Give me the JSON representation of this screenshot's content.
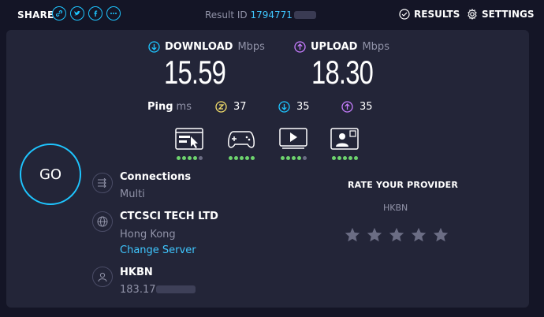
{
  "header": {
    "share_label": "SHARE",
    "result_id_label": "Result ID",
    "result_id_value": "1794771",
    "results_label": "RESULTS",
    "settings_label": "SETTINGS"
  },
  "download": {
    "label": "DOWNLOAD",
    "unit": "Mbps",
    "value": "15.59"
  },
  "upload": {
    "label": "UPLOAD",
    "unit": "Mbps",
    "value": "18.30"
  },
  "ping": {
    "label": "Ping",
    "unit": "ms",
    "idle": "37",
    "download": "35",
    "upload": "35"
  },
  "app_ratings": [
    {
      "icon": "web-browsing-icon",
      "score": 4,
      "max": 5
    },
    {
      "icon": "gaming-icon",
      "score": 5,
      "max": 5
    },
    {
      "icon": "video-streaming-icon",
      "score": 4,
      "max": 5
    },
    {
      "icon": "video-call-icon",
      "score": 5,
      "max": 5
    }
  ],
  "go_label": "GO",
  "connections": {
    "title": "Connections",
    "value": "Multi"
  },
  "server": {
    "title": "CTCSCI TECH LTD",
    "location": "Hong Kong",
    "change_label": "Change Server"
  },
  "provider": {
    "title": "HKBN",
    "ip": "183.17"
  },
  "rate": {
    "title": "RATE YOUR PROVIDER",
    "provider": "HKBN",
    "stars": 5
  },
  "colors": {
    "background": "#141526",
    "panel": "#232538",
    "accent_cyan": "#1ec5ff",
    "upload_purple": "#c77dff",
    "ping_yellow": "#f5e06b",
    "rating_green": "#6dd36d"
  }
}
